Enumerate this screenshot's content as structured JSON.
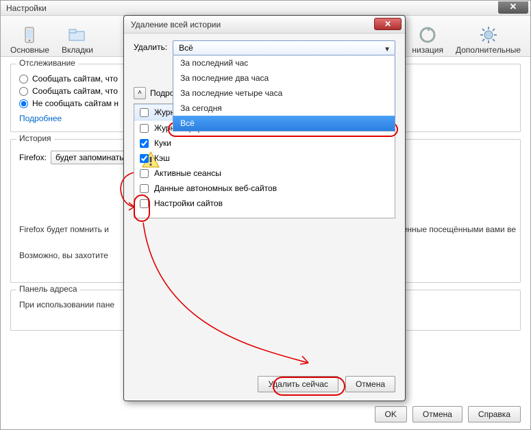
{
  "settings": {
    "title": "Настройки",
    "toolbar": {
      "main": "Основные",
      "tabs": "Вкладки",
      "sync": "низация",
      "extras": "Дополнительные"
    },
    "tracking": {
      "legend": "Отслеживание",
      "opt1": "Сообщать сайтам, что",
      "opt2": "Сообщать сайтам, что",
      "opt3": "Не сообщать сайтам н",
      "more": "Подробнее"
    },
    "history": {
      "legend": "История",
      "firefox_label": "Firefox:",
      "mode": "будет запоминать",
      "note1": "Firefox будет помнить и",
      "note1b": "ки, оставленные посещёнными вами ве",
      "note2": "Возможно, вы захотите"
    },
    "addressbar": {
      "legend": "Панель адреса",
      "label": "При использовании пане"
    },
    "buttons": {
      "ok": "OK",
      "cancel": "Отмена",
      "help": "Справка"
    }
  },
  "dialog": {
    "title": "Удаление всей истории",
    "delete_label": "Удалить:",
    "selected": "Всё",
    "options": [
      "За последний час",
      "За последние два часа",
      "За последние четыре часа",
      "За сегодня",
      "Всё"
    ],
    "details_label": "Подробности",
    "checks": [
      {
        "label": "Журнал посещений и загрузок",
        "checked": false,
        "highlight": true
      },
      {
        "label": "Журнал форм и поиска",
        "checked": false
      },
      {
        "label": "Куки",
        "checked": true
      },
      {
        "label": "Кэш",
        "checked": true
      },
      {
        "label": "Активные сеансы",
        "checked": false
      },
      {
        "label": "Данные автономных веб-сайтов",
        "checked": false
      },
      {
        "label": "Настройки сайтов",
        "checked": false
      }
    ],
    "buttons": {
      "delete_now": "Удалить сейчас",
      "cancel": "Отмена"
    }
  }
}
